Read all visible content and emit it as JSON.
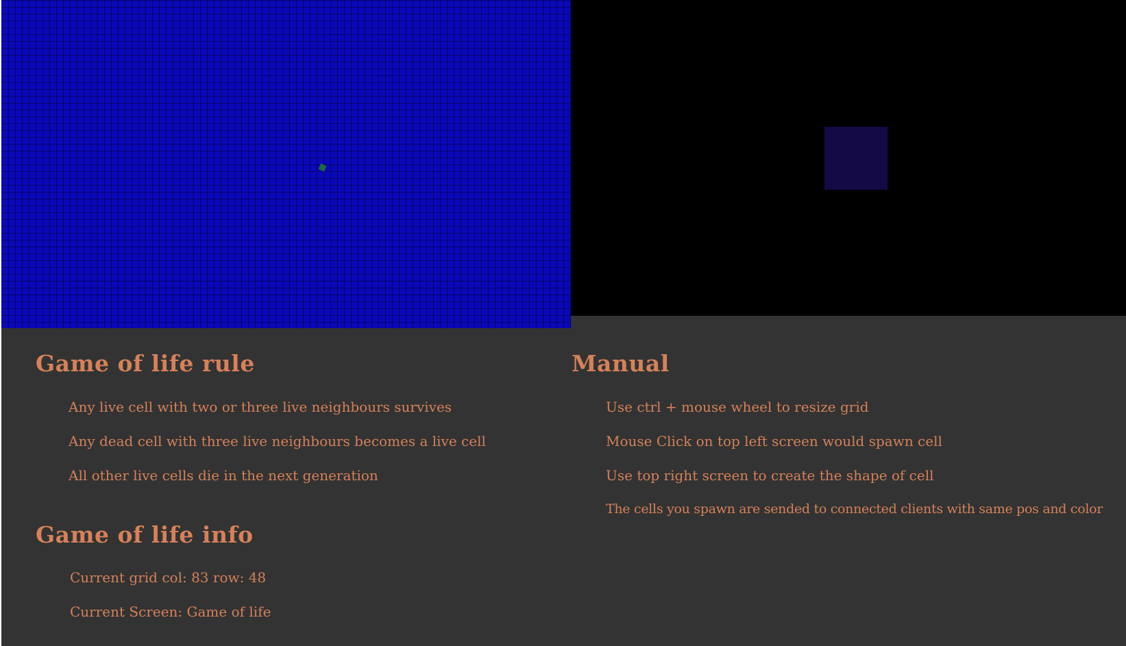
{
  "rules": {
    "title": "Game of life rule",
    "items": [
      "Any live cell with two or three live neighbours survives",
      "Any dead cell with three live neighbours becomes a live cell",
      "All other live cells die in the next generation"
    ]
  },
  "info": {
    "title": "Game of life info",
    "grid_line": "Current grid  col: 83  row: 48",
    "screen_line": "Current Screen: Game of life",
    "grid_cols": 83,
    "grid_rows": 48
  },
  "manual": {
    "title": "Manual",
    "items": [
      "Use ctrl + mouse wheel to resize grid",
      "Mouse Click on top left screen would spawn cell",
      "Use top right screen to create the shape of cell",
      "The cells you spawn are sended to connected clients with same pos and color"
    ]
  },
  "colors": {
    "grid_background": "#0a08b8",
    "shape_panel_background": "#000000",
    "shape_cell": "#140a45",
    "info_background": "#333333",
    "text": "#d6815a",
    "live_cell": "#1e6b3a"
  }
}
